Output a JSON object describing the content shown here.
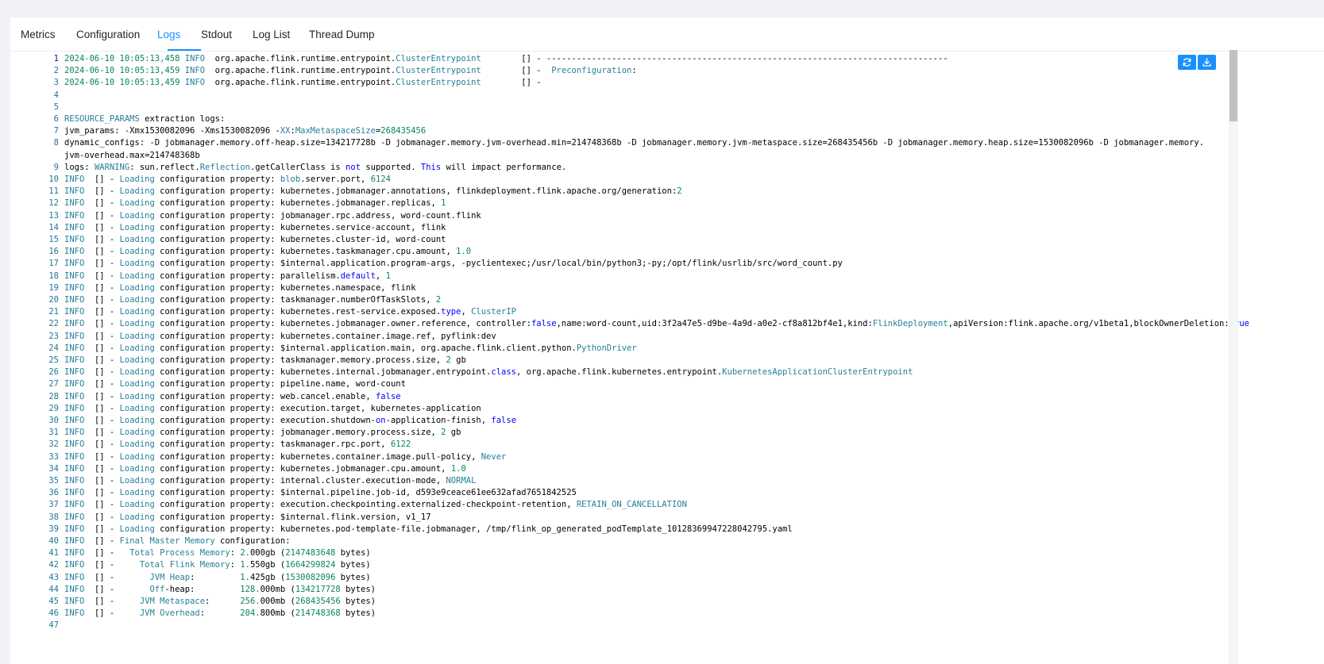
{
  "tabs": [
    {
      "label": "Metrics",
      "active": false
    },
    {
      "label": "Configuration",
      "active": false
    },
    {
      "label": "Logs",
      "active": true
    },
    {
      "label": "Stdout",
      "active": false
    },
    {
      "label": "Log List",
      "active": false
    },
    {
      "label": "Thread Dump",
      "active": false
    }
  ],
  "toolbar": {
    "refresh_icon": "refresh-icon",
    "download_icon": "download-icon"
  },
  "colors": {
    "accent": "#1890ff",
    "line_number": "#237893",
    "number": "#098658",
    "type": "#267f99",
    "keyword": "#0000ff"
  },
  "log": {
    "lines": [
      {
        "num": "1",
        "text": "2024-06-10 10:05:13,458 INFO  org.apache.flink.runtime.entrypoint.ClusterEntrypoint        [] - --------------------------------------------------------------------------------"
      },
      {
        "num": "2",
        "text": "2024-06-10 10:05:13,459 INFO  org.apache.flink.runtime.entrypoint.ClusterEntrypoint        [] -  Preconfiguration:"
      },
      {
        "num": "3",
        "text": "2024-06-10 10:05:13,459 INFO  org.apache.flink.runtime.entrypoint.ClusterEntrypoint        [] -"
      },
      {
        "num": "4",
        "text": ""
      },
      {
        "num": "5",
        "text": ""
      },
      {
        "num": "6",
        "text": "RESOURCE_PARAMS extraction logs:"
      },
      {
        "num": "7",
        "text": "jvm_params: -Xmx1530082096 -Xms1530082096 -XX:MaxMetaspaceSize=268435456"
      },
      {
        "num": "8",
        "text": "dynamic_configs: -D jobmanager.memory.off-heap.size=134217728b -D jobmanager.memory.jvm-overhead.min=214748368b -D jobmanager.memory.jvm-metaspace.size=268435456b -D jobmanager.memory.heap.size=1530082096b -D jobmanager.memory."
      },
      {
        "num": "",
        "text": "jvm-overhead.max=214748368b"
      },
      {
        "num": "9",
        "text": "logs: WARNING: sun.reflect.Reflection.getCallerClass is not supported. This will impact performance."
      },
      {
        "num": "10",
        "text": "INFO  [] - Loading configuration property: blob.server.port, 6124"
      },
      {
        "num": "11",
        "text": "INFO  [] - Loading configuration property: kubernetes.jobmanager.annotations, flinkdeployment.flink.apache.org/generation:2"
      },
      {
        "num": "12",
        "text": "INFO  [] - Loading configuration property: kubernetes.jobmanager.replicas, 1"
      },
      {
        "num": "13",
        "text": "INFO  [] - Loading configuration property: jobmanager.rpc.address, word-count.flink"
      },
      {
        "num": "14",
        "text": "INFO  [] - Loading configuration property: kubernetes.service-account, flink"
      },
      {
        "num": "15",
        "text": "INFO  [] - Loading configuration property: kubernetes.cluster-id, word-count"
      },
      {
        "num": "16",
        "text": "INFO  [] - Loading configuration property: kubernetes.taskmanager.cpu.amount, 1.0"
      },
      {
        "num": "17",
        "text": "INFO  [] - Loading configuration property: $internal.application.program-args, -pyclientexec;/usr/local/bin/python3;-py;/opt/flink/usrlib/src/word_count.py"
      },
      {
        "num": "18",
        "text": "INFO  [] - Loading configuration property: parallelism.default, 1"
      },
      {
        "num": "19",
        "text": "INFO  [] - Loading configuration property: kubernetes.namespace, flink"
      },
      {
        "num": "20",
        "text": "INFO  [] - Loading configuration property: taskmanager.numberOfTaskSlots, 2"
      },
      {
        "num": "21",
        "text": "INFO  [] - Loading configuration property: kubernetes.rest-service.exposed.type, ClusterIP"
      },
      {
        "num": "22",
        "text": "INFO  [] - Loading configuration property: kubernetes.jobmanager.owner.reference, controller:false,name:word-count,uid:3f2a47e5-d9be-4a9d-a0e2-cf8a812bf4e1,kind:FlinkDeployment,apiVersion:flink.apache.org/v1beta1,blockOwnerDeletion:true"
      },
      {
        "num": "23",
        "text": "INFO  [] - Loading configuration property: kubernetes.container.image.ref, pyflink:dev"
      },
      {
        "num": "24",
        "text": "INFO  [] - Loading configuration property: $internal.application.main, org.apache.flink.client.python.PythonDriver"
      },
      {
        "num": "25",
        "text": "INFO  [] - Loading configuration property: taskmanager.memory.process.size, 2 gb"
      },
      {
        "num": "26",
        "text": "INFO  [] - Loading configuration property: kubernetes.internal.jobmanager.entrypoint.class, org.apache.flink.kubernetes.entrypoint.KubernetesApplicationClusterEntrypoint"
      },
      {
        "num": "27",
        "text": "INFO  [] - Loading configuration property: pipeline.name, word-count"
      },
      {
        "num": "28",
        "text": "INFO  [] - Loading configuration property: web.cancel.enable, false"
      },
      {
        "num": "29",
        "text": "INFO  [] - Loading configuration property: execution.target, kubernetes-application"
      },
      {
        "num": "30",
        "text": "INFO  [] - Loading configuration property: execution.shutdown-on-application-finish, false"
      },
      {
        "num": "31",
        "text": "INFO  [] - Loading configuration property: jobmanager.memory.process.size, 2 gb"
      },
      {
        "num": "32",
        "text": "INFO  [] - Loading configuration property: taskmanager.rpc.port, 6122"
      },
      {
        "num": "33",
        "text": "INFO  [] - Loading configuration property: kubernetes.container.image.pull-policy, Never"
      },
      {
        "num": "34",
        "text": "INFO  [] - Loading configuration property: kubernetes.jobmanager.cpu.amount, 1.0"
      },
      {
        "num": "35",
        "text": "INFO  [] - Loading configuration property: internal.cluster.execution-mode, NORMAL"
      },
      {
        "num": "36",
        "text": "INFO  [] - Loading configuration property: $internal.pipeline.job-id, d593e9ceace61ee632afad7651842525"
      },
      {
        "num": "37",
        "text": "INFO  [] - Loading configuration property: execution.checkpointing.externalized-checkpoint-retention, RETAIN_ON_CANCELLATION"
      },
      {
        "num": "38",
        "text": "INFO  [] - Loading configuration property: $internal.flink.version, v1_17"
      },
      {
        "num": "39",
        "text": "INFO  [] - Loading configuration property: kubernetes.pod-template-file.jobmanager, /tmp/flink_op_generated_podTemplate_10128369947228042795.yaml"
      },
      {
        "num": "40",
        "text": "INFO  [] - Final Master Memory configuration:"
      },
      {
        "num": "41",
        "text": "INFO  [] -   Total Process Memory: 2.000gb (2147483648 bytes)"
      },
      {
        "num": "42",
        "text": "INFO  [] -     Total Flink Memory: 1.550gb (1664299824 bytes)"
      },
      {
        "num": "43",
        "text": "INFO  [] -       JVM Heap:         1.425gb (1530082096 bytes)"
      },
      {
        "num": "44",
        "text": "INFO  [] -       Off-heap:         128.000mb (134217728 bytes)"
      },
      {
        "num": "45",
        "text": "INFO  [] -     JVM Metaspace:      256.000mb (268435456 bytes)"
      },
      {
        "num": "46",
        "text": "INFO  [] -     JVM Overhead:       204.800mb (214748368 bytes)"
      },
      {
        "num": "47",
        "text": ""
      }
    ]
  }
}
